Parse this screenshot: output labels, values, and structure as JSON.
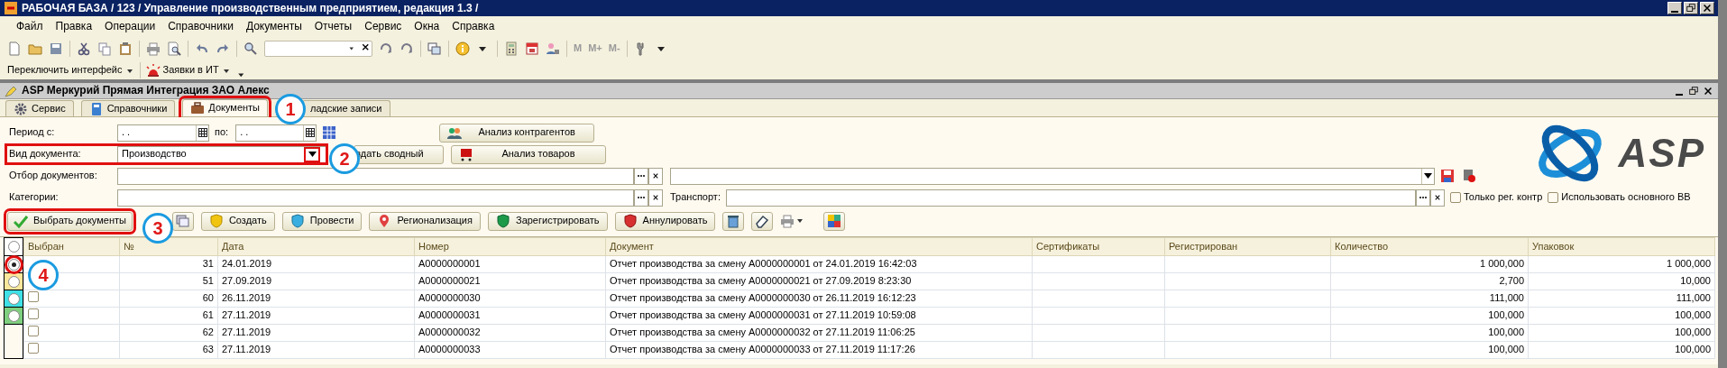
{
  "window": {
    "title": "РАБОЧАЯ БАЗА / 123 /  Управление производственным предприятием, редакция 1.3 /"
  },
  "menu": [
    "Файл",
    "Правка",
    "Операции",
    "Справочники",
    "Документы",
    "Отчеты",
    "Сервис",
    "Окна",
    "Справка"
  ],
  "toolbar": {
    "memory_buttons": [
      "M",
      "M+",
      "M-"
    ]
  },
  "toolbar2": {
    "switch_interface": "Переключить интерфейс",
    "requests": "Заявки в ИТ"
  },
  "subwindow": {
    "title": "ASP Меркурий Прямая Интеграция ЗАО Алекс"
  },
  "tabs": [
    {
      "label": "Сервис",
      "selected": false,
      "highlighted": false
    },
    {
      "label": "Справочники",
      "selected": false,
      "highlighted": false
    },
    {
      "label": "Документы",
      "selected": true,
      "highlighted": true
    },
    {
      "label": "ладские записи",
      "selected": false,
      "highlighted": false
    }
  ],
  "form": {
    "period_from": {
      "label": "Период с:",
      "value": ". ."
    },
    "period_to": {
      "label": "по:",
      "value": ". ."
    },
    "doc_type": {
      "label": "Вид документа:",
      "value": "Производство",
      "highlighted": true,
      "dropdown_highlighted": true
    },
    "doc_filter": {
      "label": "Отбор документов:"
    },
    "categories": {
      "label": "Категории:"
    },
    "transport": {
      "label": "Транспорт:"
    },
    "options": [
      {
        "label": "Только рег. контр",
        "checked": false
      },
      {
        "label": "Использовать основного ВВ",
        "checked": false
      }
    ]
  },
  "summary_button": "здать сводный",
  "analysis_buttons": [
    "Анализ контрагентов",
    "Анализ товаров"
  ],
  "logo": {
    "text": "ASP"
  },
  "actions": [
    {
      "label": "Выбрать документы",
      "kind": "check",
      "highlighted": true
    },
    {
      "label": "Создать",
      "kind": "shield-yellow",
      "highlighted": false
    },
    {
      "label": "Провести",
      "kind": "shield-blue",
      "highlighted": false
    },
    {
      "label": "Регионализация",
      "kind": "pin",
      "highlighted": false
    },
    {
      "label": "Зарегистрировать",
      "kind": "shield-green",
      "highlighted": false
    },
    {
      "label": "Аннулировать",
      "kind": "shield-red",
      "highlighted": false
    }
  ],
  "status_strip": [
    {
      "color": "#ffffff",
      "selected": false,
      "highlighted": false
    },
    {
      "color": "#ffffff",
      "selected": true,
      "highlighted": true
    },
    {
      "color": "#fbe79c",
      "selected": false,
      "highlighted": false
    },
    {
      "color": "#3fe0e6",
      "selected": false,
      "highlighted": false
    },
    {
      "color": "#7fcf7f",
      "selected": false,
      "highlighted": false
    }
  ],
  "table": {
    "columns": [
      "Выбран",
      "№",
      "Дата",
      "Номер",
      "Документ",
      "Сертификаты",
      "Регистрирован",
      "Количество",
      "Упаковок"
    ],
    "rows": [
      {
        "number": "31",
        "date": "24.01.2019",
        "doc_no": "A0000000001",
        "document": "Отчет производства за смену A0000000001 от 24.01.2019 16:42:03",
        "quantity": "1 000,000",
        "packages": "1 000,000"
      },
      {
        "number": "51",
        "date": "27.09.2019",
        "doc_no": "A0000000021",
        "document": "Отчет производства за смену A0000000021 от 27.09.2019 8:23:30",
        "quantity": "2,700",
        "packages": "10,000"
      },
      {
        "checked": false,
        "number": "60",
        "date": "26.11.2019",
        "doc_no": "A0000000030",
        "document": "Отчет производства за смену A0000000030 от 26.11.2019 16:12:23",
        "quantity": "111,000",
        "packages": "111,000"
      },
      {
        "checked": false,
        "number": "61",
        "date": "27.11.2019",
        "doc_no": "A0000000031",
        "document": "Отчет производства за смену A0000000031 от 27.11.2019 10:59:08",
        "quantity": "100,000",
        "packages": "100,000"
      },
      {
        "checked": false,
        "number": "62",
        "date": "27.11.2019",
        "doc_no": "A0000000032",
        "document": "Отчет производства за смену A0000000032 от 27.11.2019 11:06:25",
        "quantity": "100,000",
        "packages": "100,000"
      },
      {
        "checked": false,
        "number": "63",
        "date": "27.11.2019",
        "doc_no": "A0000000033",
        "document": "Отчет производства за смену A0000000033 от 27.11.2019 11:17:26",
        "quantity": "100,000",
        "packages": "100,000"
      }
    ]
  },
  "callouts": [
    "1",
    "2",
    "3",
    "4"
  ]
}
